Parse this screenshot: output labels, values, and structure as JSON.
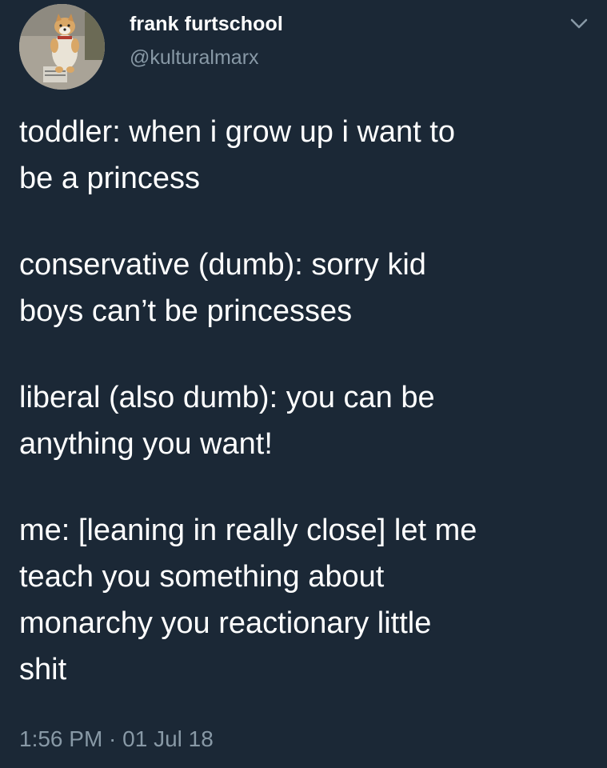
{
  "user": {
    "display_name": "frank furtschool",
    "handle": "@kulturalmarx"
  },
  "tweet": {
    "paragraphs": [
      "toddler: when i grow up i want to\nbe a princess",
      "conservative (dumb): sorry kid\nboys can’t be princesses",
      "liberal (also dumb): you can be\nanything you want!",
      "me: [leaning in really close] let me\nteach you something about\nmonarchy you reactionary little\nshit"
    ],
    "timestamp": "1:56 PM · 01 Jul 18"
  },
  "icons": {
    "more": "chevron-down-icon",
    "avatar": "dog-avatar"
  },
  "colors": {
    "background": "#1b2836",
    "text": "#ffffff",
    "secondary_text": "#8899a6"
  }
}
